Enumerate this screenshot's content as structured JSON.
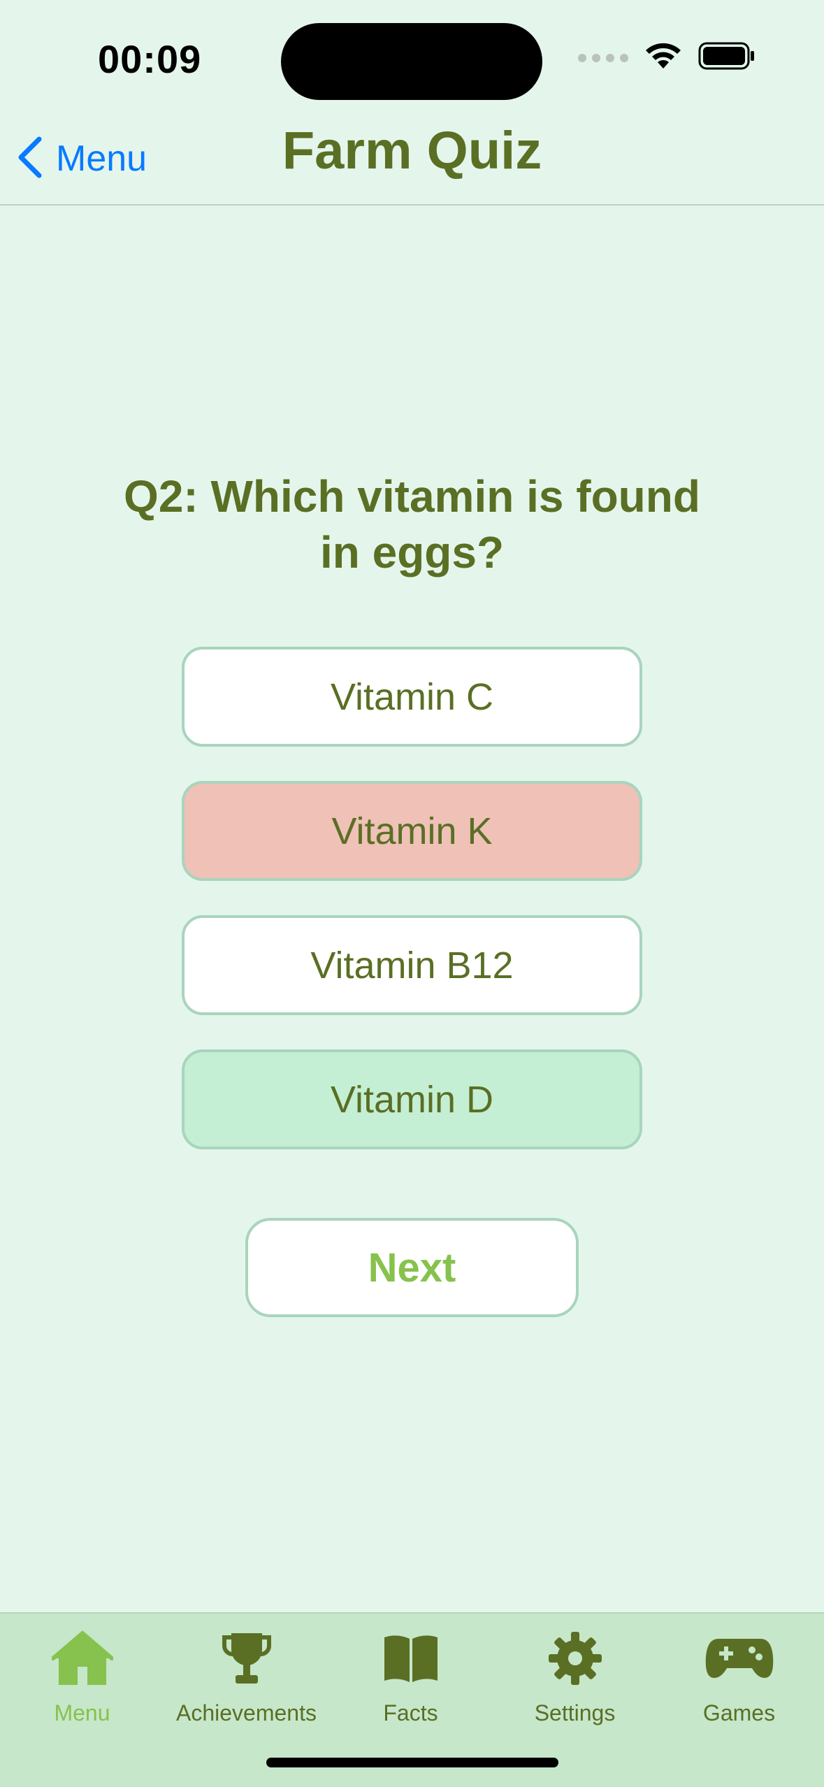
{
  "status_bar": {
    "time": "00:09"
  },
  "nav": {
    "back_label": "Menu",
    "title": "Farm Quiz"
  },
  "quiz": {
    "question": "Q2: Which vitamin is found in eggs?",
    "answers": [
      {
        "label": "Vitamin C",
        "state": "neutral"
      },
      {
        "label": "Vitamin K",
        "state": "wrong"
      },
      {
        "label": "Vitamin B12",
        "state": "neutral"
      },
      {
        "label": "Vitamin D",
        "state": "correct"
      }
    ],
    "next_label": "Next"
  },
  "tabs": [
    {
      "label": "Menu",
      "icon": "house-icon",
      "active": true
    },
    {
      "label": "Achievements",
      "icon": "trophy-icon",
      "active": false
    },
    {
      "label": "Facts",
      "icon": "book-icon",
      "active": false
    },
    {
      "label": "Settings",
      "icon": "gear-icon",
      "active": false
    },
    {
      "label": "Games",
      "icon": "gamecontroller-icon",
      "active": false
    }
  ],
  "colors": {
    "background": "#e4f6ec",
    "title_green": "#5a6f24",
    "accent_green": "#86c24d",
    "wrong": "#efc1b7",
    "correct": "#c4efd4",
    "link_blue": "#0a7aff"
  }
}
